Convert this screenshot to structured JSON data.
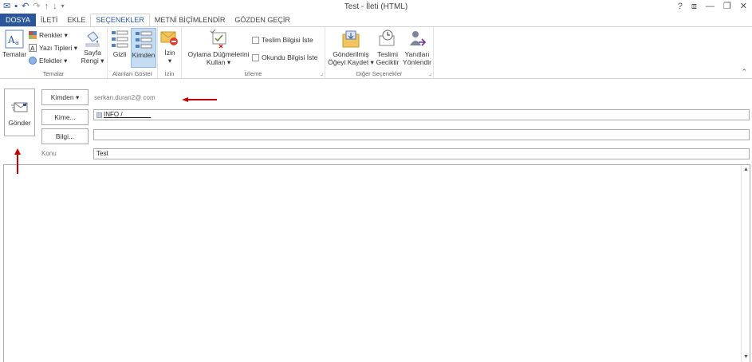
{
  "window": {
    "title": "Test - İleti (HTML)",
    "controls": [
      "?",
      "⧈",
      "—",
      "❐",
      "✕"
    ]
  },
  "qat": {
    "icons": [
      "mail-icon",
      "save-icon",
      "undo-icon",
      "redo-icon",
      "up-icon",
      "down-icon",
      "customize-icon"
    ]
  },
  "tabs": [
    {
      "label": "DOSYA"
    },
    {
      "label": "İLETİ"
    },
    {
      "label": "EKLE"
    },
    {
      "label": "SEÇENEKLER"
    },
    {
      "label": "METNİ BİÇİMLENDİR"
    },
    {
      "label": "GÖZDEN GEÇİR"
    }
  ],
  "ribbon": {
    "temalar": {
      "group_label": "Temalar",
      "themes_label": "Temalar",
      "colors_label": "Renkler ▾",
      "fonts_label": "Yazı Tipleri ▾",
      "effects_label": "Efektler ▾",
      "page_color_line1": "Sayfa",
      "page_color_line2": "Rengi ▾"
    },
    "alanlar": {
      "group_label": "Alanları Göster",
      "bcc_label": "Gizli",
      "from_label": "Kimden"
    },
    "izin": {
      "group_label": "İzin",
      "permission_label": "İzin",
      "permission_arrow": "▾"
    },
    "izleme": {
      "group_label": "İzleme",
      "voting_line1": "Oylama Düğmelerini",
      "voting_line2": "Kullan ▾",
      "delivery_receipt": "Teslim Bilgisi İste",
      "read_receipt": "Okundu Bilgisi İste"
    },
    "diger": {
      "group_label": "Diğer Seçenekler",
      "save_sent_line1": "Gönderilmiş",
      "save_sent_line2": "Öğeyi Kaydet ▾",
      "delay_line1": "Teslimi",
      "delay_line2": "Geciktir",
      "direct_line1": "Yanıtları",
      "direct_line2": "Yönlendir"
    },
    "collapse_glyph": "⌃",
    "launcher_glyph": "⌟"
  },
  "header": {
    "send_label": "Gönder",
    "from_button": "Kimden ▾",
    "from_value": "serkan.duran2@        com",
    "to_button": "Kime...",
    "to_recipient": "INFO /________",
    "cc_button": "Bilgi...",
    "cc_value": "",
    "subject_label": "Konu",
    "subject_value": "Test"
  },
  "scroll": {
    "up": "▲",
    "down": "▼"
  },
  "colors": {
    "accent": "#2b579a",
    "arrow": "#c00000",
    "selected": "#c5dcf3"
  }
}
